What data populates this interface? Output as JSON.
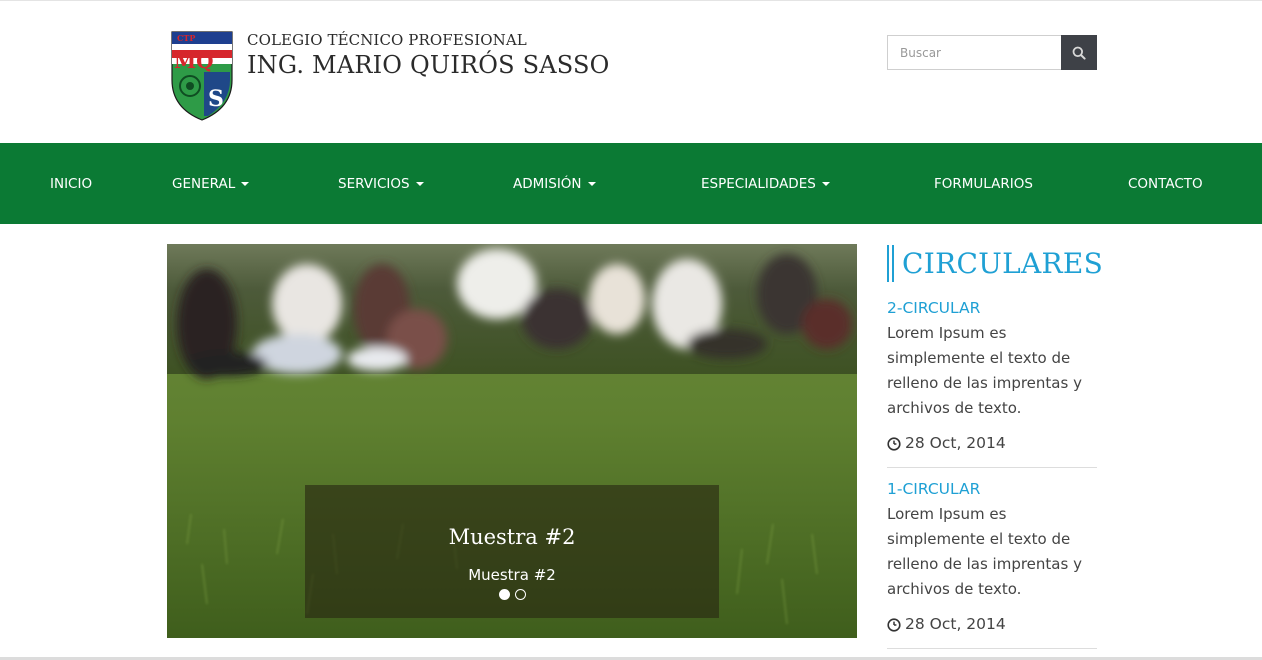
{
  "header": {
    "school_type": "COLEGIO TÉCNICO PROFESIONAL",
    "school_name": "ING. MARIO QUIRÓS SASSO",
    "logo": {
      "top_text": "CTP",
      "letters": "MQS",
      "colors": [
        "#1e3f8f",
        "#d6262c",
        "#2e9b47",
        "#ffffff"
      ]
    },
    "search": {
      "placeholder": "Buscar",
      "button_icon": "search-icon"
    }
  },
  "nav": {
    "background": "#0b7a34",
    "items": [
      {
        "label": "INICIO",
        "dropdown": false
      },
      {
        "label": "GENERAL",
        "dropdown": true
      },
      {
        "label": "SERVICIOS",
        "dropdown": true
      },
      {
        "label": "ADMISIÓN",
        "dropdown": true
      },
      {
        "label": "ESPECIALIDADES",
        "dropdown": true
      },
      {
        "label": "FORMULARIOS",
        "dropdown": false
      },
      {
        "label": "CONTACTO",
        "dropdown": false
      }
    ]
  },
  "slider": {
    "caption_title": "Muestra #2",
    "caption_text": "Muestra #2",
    "slide_count": 2,
    "active_slide": 1
  },
  "circulares": {
    "heading": "CIRCULARES",
    "accent": "#1fa0d4",
    "items": [
      {
        "title": "2-CIRCULAR",
        "text": "Lorem Ipsum es simplemente el texto de relleno de las imprentas y archivos de texto.",
        "date": "28 Oct, 2014",
        "date_icon": "clock-icon"
      },
      {
        "title": "1-CIRCULAR",
        "text": "Lorem Ipsum es simplemente el texto de relleno de las imprentas y archivos de texto.",
        "date": "28 Oct, 2014",
        "date_icon": "clock-icon"
      }
    ]
  }
}
